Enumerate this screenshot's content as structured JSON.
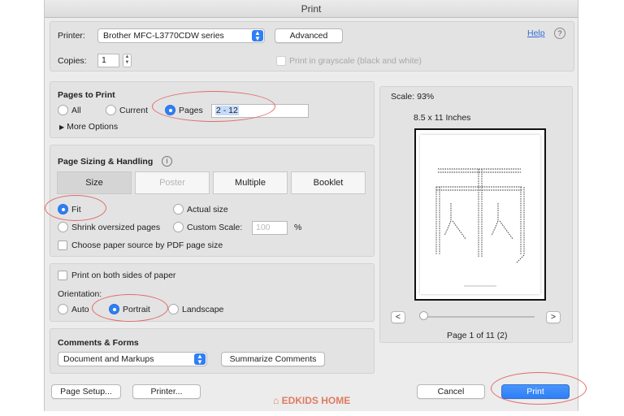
{
  "window": {
    "title": "Print"
  },
  "top": {
    "printer_label": "Printer:",
    "printer_value": "Brother MFC-L3770CDW series",
    "advanced": "Advanced",
    "help": "Help",
    "help_icon": "?",
    "copies_label": "Copies:",
    "copies_value": "1",
    "grayscale_label": "Print in grayscale (black and white)"
  },
  "pages": {
    "title": "Pages to Print",
    "all": "All",
    "current": "Current",
    "pages": "Pages",
    "range": "2 - 12",
    "more_options": "More Options",
    "selected": "pages"
  },
  "sizing": {
    "title": "Page Sizing & Handling",
    "info_icon": "i",
    "tabs": [
      "Size",
      "Poster",
      "Multiple",
      "Booklet"
    ],
    "fit": "Fit",
    "actual_size": "Actual size",
    "shrink": "Shrink oversized pages",
    "custom_scale": "Custom Scale:",
    "scale_value": "100",
    "percent": "%",
    "paper_source": "Choose paper source by PDF page size"
  },
  "orientation": {
    "both_sides": "Print on both sides of paper",
    "label": "Orientation:",
    "auto": "Auto",
    "portrait": "Portrait",
    "landscape": "Landscape"
  },
  "comments": {
    "title": "Comments & Forms",
    "value": "Document and Markups",
    "summarize": "Summarize Comments"
  },
  "preview": {
    "scale": "Scale: 93%",
    "paper": "8.5 x 11 Inches",
    "prev": "<",
    "next": ">",
    "page_info": "Page 1 of 11 (2)",
    "slider_value": 0
  },
  "bottom": {
    "page_setup": "Page Setup...",
    "printer": "Printer...",
    "watermark": "EDKIDS HOME",
    "cancel": "Cancel",
    "print": "Print"
  },
  "colors": {
    "accent": "#2f7ef6",
    "highlight": "#e26a6a",
    "watermark": "#e07b5f"
  }
}
